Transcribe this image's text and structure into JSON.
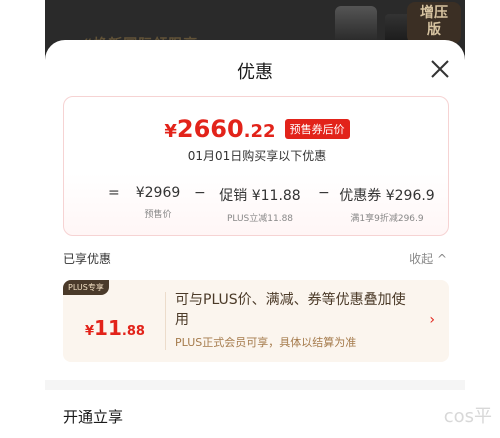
{
  "background_banner": {
    "promo_text": "“焕新国际领限享…",
    "seal_text": "增压\n版"
  },
  "sheet": {
    "title": "优惠"
  },
  "price_summary": {
    "currency": "¥",
    "final_int": "2660",
    "final_dec": ".22",
    "final_tag": "预售券后价",
    "date_line": "01月01日购买享以下优惠",
    "formula": {
      "eq": "=",
      "minus": "−",
      "items": [
        {
          "value": "¥2969",
          "label": "预售价"
        },
        {
          "value": "促销 ¥11.88",
          "label": "PLUS立减11.88"
        },
        {
          "value": "优惠券 ¥296.9",
          "label": "满1享9折减296.9"
        }
      ]
    }
  },
  "enjoyed": {
    "label": "已享优惠",
    "collapse": "收起 ^"
  },
  "plus_offer": {
    "badge": "PLUS专享",
    "currency": "¥",
    "int": "11",
    "dec": ".88",
    "description": "可与PLUS价、满减、券等优惠叠加使用",
    "note": "PLUS正式会员可享，具体以结算为准",
    "arrow": "›"
  },
  "open_section": {
    "title": "开通立享"
  },
  "watermark": "cos平",
  "colors": {
    "accent_red": "#e2231a",
    "plus_bg": "#fbf5ee",
    "plus_badge": "#4a3a2a"
  }
}
